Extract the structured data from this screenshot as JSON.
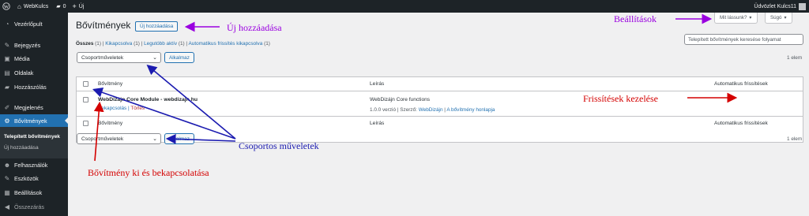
{
  "adminbar": {
    "site_name": "WebKulcs",
    "comments_count": "0",
    "new_label": "Új",
    "greeting": "Üdvözlet Kulcs11"
  },
  "sidebar": {
    "items": [
      {
        "label": "Vezérlőpult",
        "icon": "dashboard-icon"
      },
      {
        "label": "Bejegyzés",
        "icon": "pin-icon"
      },
      {
        "label": "Média",
        "icon": "media-icon"
      },
      {
        "label": "Oldalak",
        "icon": "page-icon"
      },
      {
        "label": "Hozzászólás",
        "icon": "comment-icon"
      },
      {
        "label": "Megjelenés",
        "icon": "brush-icon"
      },
      {
        "label": "Bővítmények",
        "icon": "plugin-icon"
      },
      {
        "label": "Felhasználók",
        "icon": "user-icon"
      },
      {
        "label": "Eszközök",
        "icon": "wrench-icon"
      },
      {
        "label": "Beállítások",
        "icon": "settings-icon"
      },
      {
        "label": "Összezárás",
        "icon": "collapse-icon"
      }
    ],
    "submenu": [
      "Telepített bővítmények",
      "Új hozzáadása"
    ]
  },
  "content": {
    "title": "Bővítmények",
    "add_new": "Új hozzáadása",
    "screen_options": "Mit lássunk?",
    "help": "Súgó",
    "filters": {
      "all": "Összes",
      "all_count": "(1)",
      "inactive": "Kikapcsolva",
      "inactive_count": "(1)",
      "recent": "Legutóbb aktív",
      "recent_count": "(1)",
      "auto_off": "Automatikus frissítés kikapcsolva",
      "auto_off_count": "(1)"
    },
    "search_placeholder": "Telepített bővítmények keresése folyamat",
    "bulk_actions": "Csoportműveletek",
    "apply": "Alkalmaz",
    "count": "1 elem",
    "columns": {
      "plugin": "Bővítmény",
      "description": "Leírás",
      "auto_updates": "Automatikus frissítések"
    },
    "plugin": {
      "name": "WebDizájn Core Module - webdizajn.hu",
      "action": "Bekapcsolás",
      "delete": "Törlés",
      "description": "WebDizájn Core functions",
      "version": "1.0.0 verzió",
      "author_label": "Szerző:",
      "author": "WebDizájn",
      "homepage": "A bővítmény honlapja"
    }
  },
  "annotations": {
    "add_new": "Új hozzáadása",
    "settings": "Beállítások",
    "updates": "Frissítések kezelése",
    "bulk": "Csoportos műveletek",
    "toggle": "Bővítmény ki és bekapcsolatása"
  },
  "colors": {
    "blue_arrow": "#1b1bb0",
    "purple_arrow": "#9a00e0",
    "red_arrow": "#d40000",
    "wp_blue": "#2271b1"
  }
}
